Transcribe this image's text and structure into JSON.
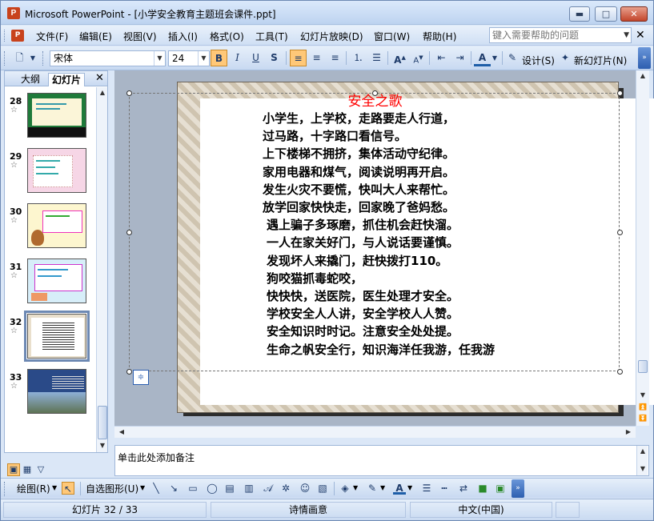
{
  "window": {
    "title": "Microsoft PowerPoint - [小学安全教育主题班会课件.ppt]",
    "app_icon": "powerpoint-icon",
    "app_icon_glyph": "P",
    "minimize": "▬",
    "maximize": "□",
    "close": "✕"
  },
  "menu": {
    "items": [
      "文件(F)",
      "编辑(E)",
      "视图(V)",
      "插入(I)",
      "格式(O)",
      "工具(T)",
      "幻灯片放映(D)",
      "窗口(W)",
      "帮助(H)"
    ],
    "help_placeholder": "键入需要帮助的问题",
    "close_doc": "✕"
  },
  "format_toolbar": {
    "font": "宋体",
    "size": "24",
    "bold": "B",
    "italic": "I",
    "underline": "U",
    "shadow": "S",
    "font_a_icon": "A",
    "design_label": "设计(S)",
    "new_slide_label": "新幻灯片(N)",
    "toolbar_options": "»"
  },
  "left_pane": {
    "tabs": [
      "大纲",
      "幻灯片"
    ],
    "close": "✕",
    "star": "☆",
    "slides": [
      {
        "num": "28",
        "bg": "#1f7a3a"
      },
      {
        "num": "29",
        "bg": "#f6d6e6"
      },
      {
        "num": "30",
        "bg": "#fdf6cf"
      },
      {
        "num": "31",
        "bg": "#d7eef9"
      },
      {
        "num": "32",
        "bg": "#e9dfcc"
      },
      {
        "num": "33",
        "bg": "#2a4a88"
      }
    ],
    "selected": "32"
  },
  "slide": {
    "title": "安全之歌",
    "lines": [
      "小学生，上学校，走路要走人行道，",
      "过马路，十字路口看信号。",
      "上下楼梯不拥挤，集体活动守纪律。",
      "家用电器和煤气，阅读说明再开启。",
      "发生火灾不要慌，快叫大人来帮忙。",
      "放学回家快快走，回家晚了爸妈愁。",
      " 遇上骗子多琢磨，抓住机会赶快溜。",
      " 一人在家关好门，与人说话要谨慎。",
      " 发现坏人来撬门，赶快拨打110。",
      " 狗咬猫抓毒蛇咬，",
      " 快快快，送医院，医生处理才安全。",
      " 学校安全人人讲，安全学校人人赞。",
      " 安全知识时时记。注意安全处处提。",
      " 生命之帆安全行，知识海洋任我游，任我游"
    ],
    "autofit_icon": "autofit-options-icon",
    "autofit_glyph": "≑"
  },
  "notes": {
    "placeholder": "单击此处添加备注"
  },
  "draw_toolbar": {
    "draw_label": "绘图(R)",
    "autoshape_label": "自选图形(U)"
  },
  "status": {
    "slide_info": "幻灯片 32 / 33",
    "design": "诗情画意",
    "language": "中文(中国)"
  },
  "view_buttons": [
    "▣",
    "▦",
    "▽"
  ]
}
